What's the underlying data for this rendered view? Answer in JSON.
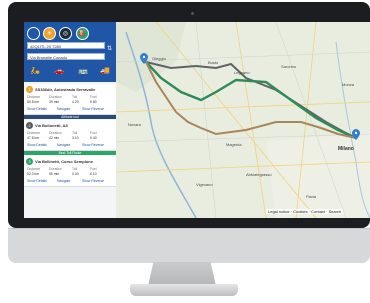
{
  "search": {
    "from_value": "42Q1ITL 20 7280",
    "to_value": "Via Brunatte Conado"
  },
  "header": {
    "circle_icons": [
      "blank-circle-icon",
      "sun-icon",
      "target-icon",
      "fuel-pump-icon"
    ],
    "swap_symbol": "⇅",
    "modes": [
      {
        "icon": "scooter-icon",
        "glyph": "🛵"
      },
      {
        "icon": "car-icon",
        "glyph": "🚗"
      },
      {
        "icon": "bus-icon",
        "glyph": "🚌"
      },
      {
        "icon": "truck-icon",
        "glyph": "🚚"
      }
    ]
  },
  "results": [
    {
      "badge": "1",
      "color": "#f0a22a",
      "title": "SS336dir, Autostrada Serravalle",
      "labels": [
        "Distance",
        "Duration",
        "Toll",
        "Fuel"
      ],
      "values": [
        "50.8 km",
        "39 min",
        "4.20",
        "5.80"
      ],
      "actions": [
        "Show Details",
        "Navigate",
        "Show Reverse"
      ],
      "strip_text": "",
      "strip_color": ""
    },
    {
      "badge": "2",
      "color": "#555b63",
      "title": "Via Bollonetti, A8",
      "labels": [
        "Distance",
        "Duration",
        "Toll",
        "Fuel"
      ],
      "values": [
        "47.5 km",
        "42 min",
        "3.10",
        "5.40"
      ],
      "actions": [
        "Show Details",
        "Navigate",
        "Show Reverse"
      ],
      "strip_text": "Altitude tool",
      "strip_color": "#2b4a7a"
    },
    {
      "badge": "3",
      "color": "#2da56a",
      "title": "Via Bellinetti, Corso Sempione",
      "labels": [
        "Distance",
        "Duration",
        "Toll",
        "Fuel"
      ],
      "values": [
        "52.0 km",
        "55 min",
        "0.00",
        "6.10"
      ],
      "actions": [
        "Show Details",
        "Navigate",
        "Show Reverse"
      ],
      "strip_text": "Best Toll Route",
      "strip_color": "#2da56a"
    }
  ],
  "map": {
    "places": [
      "Oleggio",
      "Busto",
      "Legnano",
      "Saronno",
      "Monza",
      "Magenta",
      "Milano",
      "Novara",
      "Vigevano",
      "Abbiategrasso",
      "Pavia"
    ],
    "legal": "Legal notice · Cookies · Contact · Search",
    "route_colors": [
      "#2e8b57",
      "#6b6b6b",
      "#a8855a"
    ]
  }
}
